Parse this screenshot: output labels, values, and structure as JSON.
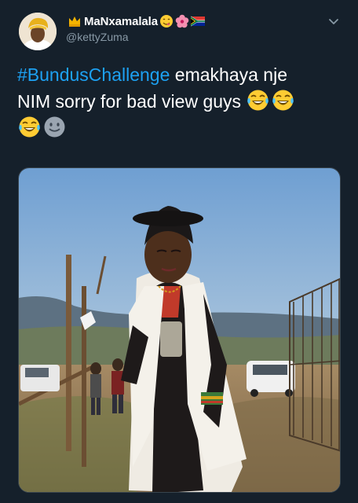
{
  "tweet": {
    "display_name": "MaNxamalala",
    "name_emojis": [
      "crown-emoji",
      "yum-emoji",
      "hibiscus-emoji",
      "south-africa-flag-emoji"
    ],
    "handle": "@kettyZuma",
    "hashtag": "#BundusChallenge",
    "text_line1_rest": " emakhaya nje",
    "text_line2": "NIM sorry for bad view guys",
    "trailing_emojis": [
      "tears-of-joy-emoji",
      "tears-of-joy-emoji",
      "tears-of-joy-emoji",
      "slight-smile-emoji"
    ]
  },
  "colors": {
    "background": "#15202b",
    "hashtag": "#1da1f2",
    "secondary_text": "#8899a6"
  }
}
